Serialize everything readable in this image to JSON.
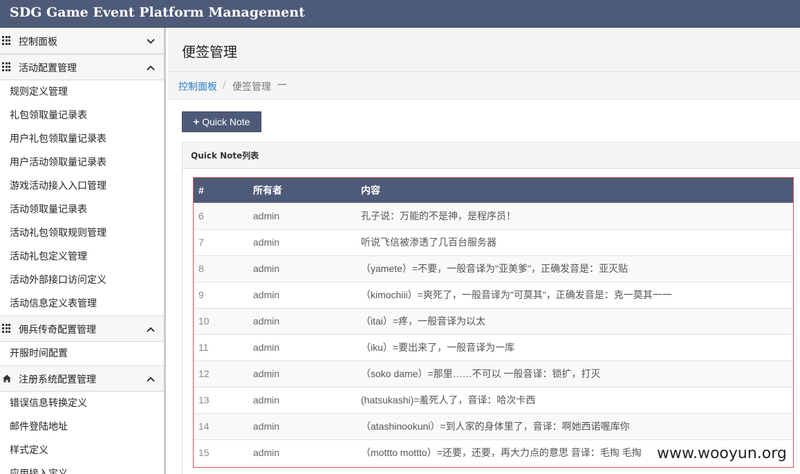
{
  "app": {
    "title": "SDG Game Event Platform Management"
  },
  "sidebar": {
    "sections": [
      {
        "label": "控制面板",
        "expanded": false,
        "icon": "grid-icon",
        "items": []
      },
      {
        "label": "活动配置管理",
        "expanded": true,
        "icon": "grid-icon",
        "items": [
          "规则定义管理",
          "礼包领取量记录表",
          "用户礼包领取量记录表",
          "用户活动领取量记录表",
          "游戏活动接入入口管理",
          "活动领取量记录表",
          "活动礼包领取规则管理",
          "活动礼包定义管理",
          "活动外部接口访问定义",
          "活动信息定义表管理"
        ]
      },
      {
        "label": "佣兵传奇配置管理",
        "expanded": true,
        "icon": "grid-icon",
        "items": [
          "开服时间配置"
        ]
      },
      {
        "label": "注册系统配置管理",
        "expanded": true,
        "icon": "home-icon",
        "items": [
          "错误信息转换定义",
          "邮件登陆地址",
          "样式定义",
          "应用接入定义"
        ]
      }
    ]
  },
  "page": {
    "title": "便签管理"
  },
  "breadcrumb": {
    "home": "控制面板",
    "separator": "/",
    "current": "便签管理",
    "suffix": "—"
  },
  "toolbar": {
    "quick_note_label": "Quick Note",
    "quick_note_icon": "+"
  },
  "panel": {
    "title": "Quick Note列表"
  },
  "table": {
    "columns": [
      "#",
      "所有者",
      "内容"
    ],
    "rows": [
      [
        "6",
        "admin",
        "孔子说：万能的不是神，是程序员！"
      ],
      [
        "7",
        "admin",
        "听说飞信被渗透了几百台服务器"
      ],
      [
        "8",
        "admin",
        "（yamete）=不要，一般音译为\"亚美爹\"，正确发音是：亚灭贴"
      ],
      [
        "9",
        "admin",
        "（kimochiii）=爽死了，一般音译为\"可莫其\"，正确发音是：克一莫其一一"
      ],
      [
        "10",
        "admin",
        "（itai）=疼，一般音译为以太"
      ],
      [
        "11",
        "admin",
        "（iku）=要出来了，一般音译为一库"
      ],
      [
        "12",
        "admin",
        "（soko dame）=那里……不可以 一般音译：锁扩，打灭"
      ],
      [
        "13",
        "admin",
        "(hatsukashi)=羞死人了，音译：哈次卡西"
      ],
      [
        "14",
        "admin",
        "（atashinookuni）=到人家的身体里了，音译：啊她西诺喔库你"
      ],
      [
        "15",
        "admin",
        "（mottto mottto）=还要，还要，再大力点的意思 音译：毛掏 毛掏"
      ]
    ]
  },
  "watermark": "www.wooyun.org",
  "colors": {
    "topbar": "#4e5b78",
    "highlight_border": "#d9534f",
    "link": "#2a7cc4"
  }
}
